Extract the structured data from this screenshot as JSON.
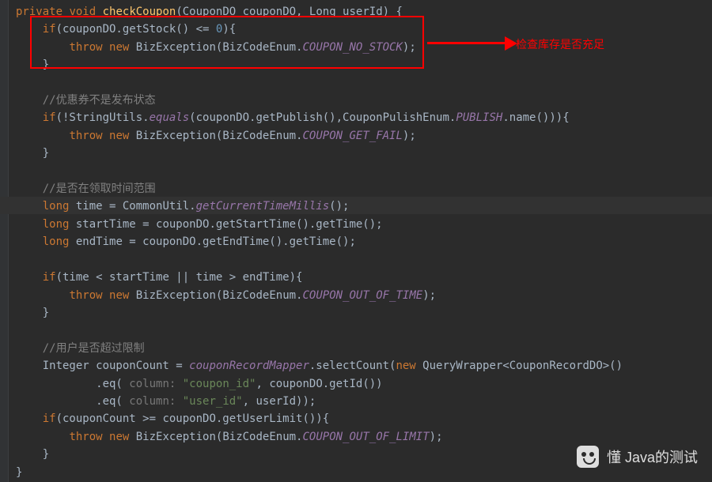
{
  "code": {
    "l1": {
      "kw1": "private",
      "kw2": "void",
      "fn": "checkCoupon",
      "params": "(CouponDO couponDO, Long userId) {"
    },
    "l2": {
      "kw": "if",
      "expr": "(couponDO.getStock() <= ",
      "num": "0",
      "rest": "){"
    },
    "l3": {
      "kw1": "throw",
      "kw2": "new",
      "call": " BizException(BizCodeEnum.",
      "enum": "COUPON_NO_STOCK",
      "end": ");"
    },
    "l4": "    }",
    "l5": "",
    "l6": {
      "cmt": "//优惠券不是发布状态"
    },
    "l7": {
      "kw": "if",
      "open": "(!StringUtils.",
      "it": "equals",
      "mid": "(couponDO.getPublish(),CouponPulishEnum.",
      "enum": "PUBLISH",
      "end": ".name())){"
    },
    "l8": {
      "kw1": "throw",
      "kw2": "new",
      "call": " BizException(BizCodeEnum.",
      "enum": "COUPON_GET_FAIL",
      "end": ");"
    },
    "l9": "    }",
    "l10": "",
    "l11": {
      "cmt": "//是否在领取时间范围"
    },
    "l12": {
      "kw": "long",
      "var": " time = CommonUtil.",
      "it": "getCurrentTimeMillis",
      "end": "();"
    },
    "l13": {
      "kw": "long",
      "rest": " startTime = couponDO.getStartTime().getTime();"
    },
    "l14": {
      "kw": "long",
      "rest": " endTime = couponDO.getEndTime().getTime();"
    },
    "l15": "",
    "l16": {
      "kw": "if",
      "rest": "(time < startTime || time > endTime){"
    },
    "l17": {
      "kw1": "throw",
      "kw2": "new",
      "call": " BizException(BizCodeEnum.",
      "enum": "COUPON_OUT_OF_TIME",
      "end": ");"
    },
    "l18": "    }",
    "l19": "",
    "l20": {
      "cmt": "//用户是否超过限制"
    },
    "l21": {
      "t1": "    Integer couponCount = ",
      "fld": "couponRecordMapper",
      "t2": ".selectCount(",
      "kw": "new",
      "t3": " QueryWrapper<CouponRecordDO>()"
    },
    "l22": {
      "pre": "            .eq( ",
      "hint": "column:",
      "str": "\"coupon_id\"",
      "rest": ", couponDO.getId())"
    },
    "l23": {
      "pre": "            .eq( ",
      "hint": "column:",
      "str": "\"user_id\"",
      "rest": ", userId));"
    },
    "l24": {
      "kw": "if",
      "rest": "(couponCount >= couponDO.getUserLimit()){"
    },
    "l25": {
      "kw1": "throw",
      "kw2": "new",
      "call": " BizException(BizCodeEnum.",
      "enum": "COUPON_OUT_OF_LIMIT",
      "end": ");"
    },
    "l26": "    }",
    "l27": "}"
  },
  "annotation": "检查库存是否充足",
  "watermark": "懂 Java的测试"
}
